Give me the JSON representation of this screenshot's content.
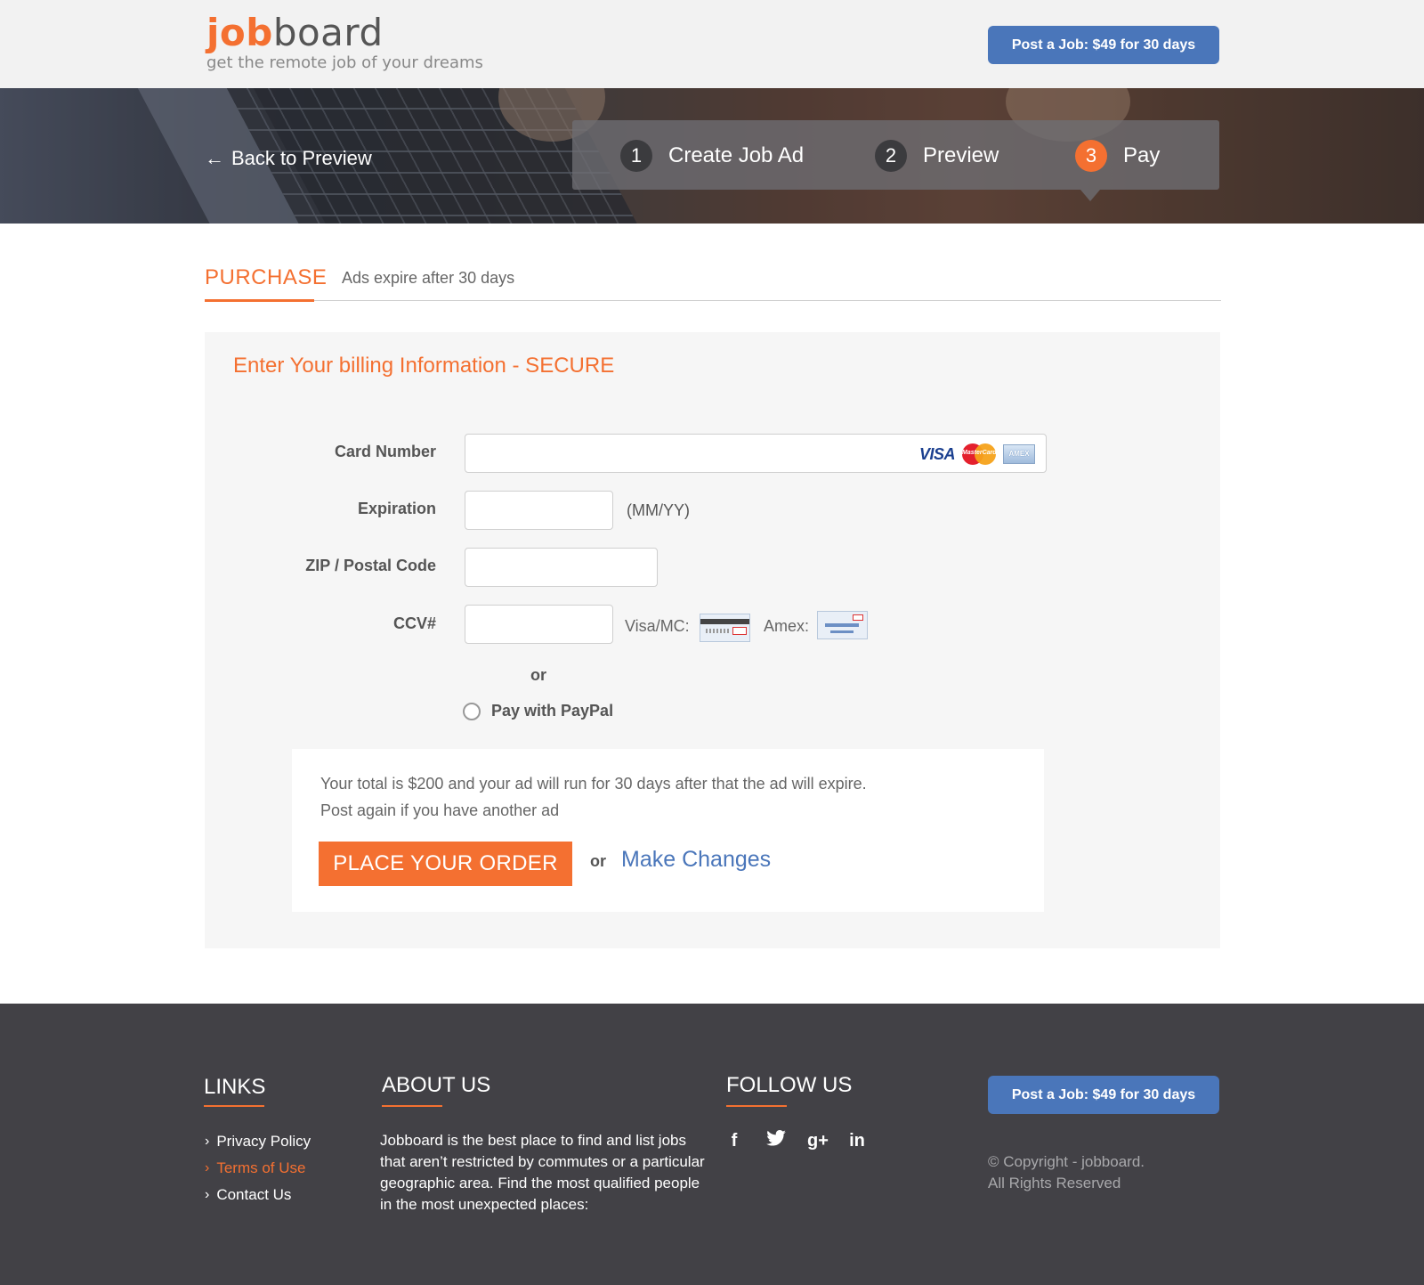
{
  "header": {
    "logo_job": "job",
    "logo_board": "board",
    "tagline": "get the remote job of your dreams",
    "post_button": "Post a Job: $49 for 30 days"
  },
  "hero": {
    "back_label": "Back to Preview",
    "steps": [
      {
        "number": "1",
        "label": "Create Job Ad"
      },
      {
        "number": "2",
        "label": "Preview"
      },
      {
        "number": "3",
        "label": "Pay",
        "active": true
      }
    ]
  },
  "purchase": {
    "title": "PURCHASE",
    "subtitle": "Ads expire after 30 days"
  },
  "billing": {
    "heading": "Enter Your billing Information - SECURE",
    "card_number_label": "Card Number",
    "card_number_value": "",
    "card_logos": [
      "VISA",
      "MasterCard",
      "AMEX"
    ],
    "expiration_label": "Expiration",
    "expiration_value": "",
    "expiration_hint": "(MM/YY)",
    "zip_label": "ZIP / Postal Code",
    "zip_value": "",
    "ccv_label": "CCV#",
    "ccv_value": "",
    "visa_mc_label": "Visa/MC:",
    "amex_label": "Amex:",
    "or_label": "or",
    "paypal_label": "Pay with PayPal",
    "paypal_selected": false
  },
  "summary": {
    "line1": "Your total is $200 and your ad will run for 30 days after that the ad will expire.",
    "line2": "Post again if you have another ad",
    "order_button": "PLACE YOUR ORDER",
    "or_label": "or",
    "make_changes": "Make Changes"
  },
  "footer": {
    "links_heading": "LINKS",
    "links": [
      {
        "label": "Privacy Policy",
        "active": false
      },
      {
        "label": "Terms of Use",
        "active": true
      },
      {
        "label": "Contact Us",
        "active": false
      }
    ],
    "about_heading": "ABOUT US",
    "about_text": "Jobboard is the best place to find and list jobs that aren’t restricted by commutes or a particular geographic area. Find the most qualified people in the most unexpected places:",
    "follow_heading": "FOLLOW US",
    "social": [
      "facebook-icon",
      "twitter-icon",
      "google-plus-icon",
      "linkedin-icon"
    ],
    "post_button": "Post a Job: $49 for 30 days",
    "copyright_line1": "© Copyright - jobboard.",
    "copyright_line2": "All Rights Reserved"
  },
  "colors": {
    "accent_orange": "#f47031",
    "brand_blue": "#4a76ba",
    "footer_bg": "#424146"
  }
}
